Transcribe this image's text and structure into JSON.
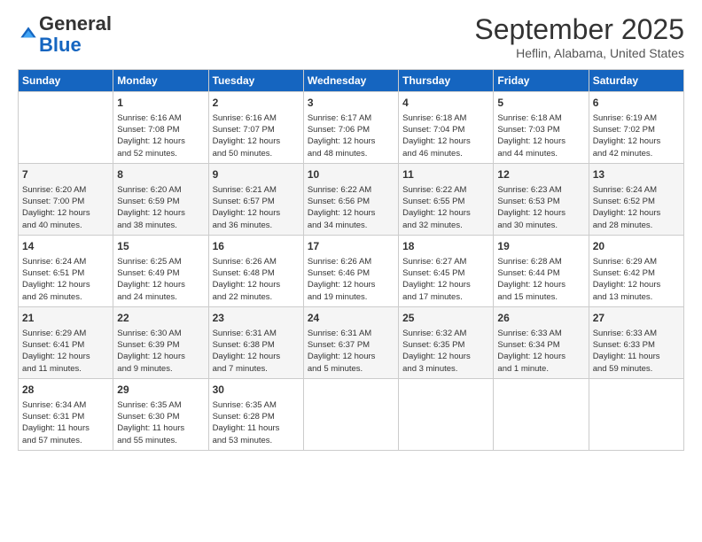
{
  "logo": {
    "general": "General",
    "blue": "Blue"
  },
  "title": "September 2025",
  "subtitle": "Heflin, Alabama, United States",
  "weekdays": [
    "Sunday",
    "Monday",
    "Tuesday",
    "Wednesday",
    "Thursday",
    "Friday",
    "Saturday"
  ],
  "weeks": [
    [
      {
        "day": "",
        "info": ""
      },
      {
        "day": "1",
        "info": "Sunrise: 6:16 AM\nSunset: 7:08 PM\nDaylight: 12 hours\nand 52 minutes."
      },
      {
        "day": "2",
        "info": "Sunrise: 6:16 AM\nSunset: 7:07 PM\nDaylight: 12 hours\nand 50 minutes."
      },
      {
        "day": "3",
        "info": "Sunrise: 6:17 AM\nSunset: 7:06 PM\nDaylight: 12 hours\nand 48 minutes."
      },
      {
        "day": "4",
        "info": "Sunrise: 6:18 AM\nSunset: 7:04 PM\nDaylight: 12 hours\nand 46 minutes."
      },
      {
        "day": "5",
        "info": "Sunrise: 6:18 AM\nSunset: 7:03 PM\nDaylight: 12 hours\nand 44 minutes."
      },
      {
        "day": "6",
        "info": "Sunrise: 6:19 AM\nSunset: 7:02 PM\nDaylight: 12 hours\nand 42 minutes."
      }
    ],
    [
      {
        "day": "7",
        "info": "Sunrise: 6:20 AM\nSunset: 7:00 PM\nDaylight: 12 hours\nand 40 minutes."
      },
      {
        "day": "8",
        "info": "Sunrise: 6:20 AM\nSunset: 6:59 PM\nDaylight: 12 hours\nand 38 minutes."
      },
      {
        "day": "9",
        "info": "Sunrise: 6:21 AM\nSunset: 6:57 PM\nDaylight: 12 hours\nand 36 minutes."
      },
      {
        "day": "10",
        "info": "Sunrise: 6:22 AM\nSunset: 6:56 PM\nDaylight: 12 hours\nand 34 minutes."
      },
      {
        "day": "11",
        "info": "Sunrise: 6:22 AM\nSunset: 6:55 PM\nDaylight: 12 hours\nand 32 minutes."
      },
      {
        "day": "12",
        "info": "Sunrise: 6:23 AM\nSunset: 6:53 PM\nDaylight: 12 hours\nand 30 minutes."
      },
      {
        "day": "13",
        "info": "Sunrise: 6:24 AM\nSunset: 6:52 PM\nDaylight: 12 hours\nand 28 minutes."
      }
    ],
    [
      {
        "day": "14",
        "info": "Sunrise: 6:24 AM\nSunset: 6:51 PM\nDaylight: 12 hours\nand 26 minutes."
      },
      {
        "day": "15",
        "info": "Sunrise: 6:25 AM\nSunset: 6:49 PM\nDaylight: 12 hours\nand 24 minutes."
      },
      {
        "day": "16",
        "info": "Sunrise: 6:26 AM\nSunset: 6:48 PM\nDaylight: 12 hours\nand 22 minutes."
      },
      {
        "day": "17",
        "info": "Sunrise: 6:26 AM\nSunset: 6:46 PM\nDaylight: 12 hours\nand 19 minutes."
      },
      {
        "day": "18",
        "info": "Sunrise: 6:27 AM\nSunset: 6:45 PM\nDaylight: 12 hours\nand 17 minutes."
      },
      {
        "day": "19",
        "info": "Sunrise: 6:28 AM\nSunset: 6:44 PM\nDaylight: 12 hours\nand 15 minutes."
      },
      {
        "day": "20",
        "info": "Sunrise: 6:29 AM\nSunset: 6:42 PM\nDaylight: 12 hours\nand 13 minutes."
      }
    ],
    [
      {
        "day": "21",
        "info": "Sunrise: 6:29 AM\nSunset: 6:41 PM\nDaylight: 12 hours\nand 11 minutes."
      },
      {
        "day": "22",
        "info": "Sunrise: 6:30 AM\nSunset: 6:39 PM\nDaylight: 12 hours\nand 9 minutes."
      },
      {
        "day": "23",
        "info": "Sunrise: 6:31 AM\nSunset: 6:38 PM\nDaylight: 12 hours\nand 7 minutes."
      },
      {
        "day": "24",
        "info": "Sunrise: 6:31 AM\nSunset: 6:37 PM\nDaylight: 12 hours\nand 5 minutes."
      },
      {
        "day": "25",
        "info": "Sunrise: 6:32 AM\nSunset: 6:35 PM\nDaylight: 12 hours\nand 3 minutes."
      },
      {
        "day": "26",
        "info": "Sunrise: 6:33 AM\nSunset: 6:34 PM\nDaylight: 12 hours\nand 1 minute."
      },
      {
        "day": "27",
        "info": "Sunrise: 6:33 AM\nSunset: 6:33 PM\nDaylight: 11 hours\nand 59 minutes."
      }
    ],
    [
      {
        "day": "28",
        "info": "Sunrise: 6:34 AM\nSunset: 6:31 PM\nDaylight: 11 hours\nand 57 minutes."
      },
      {
        "day": "29",
        "info": "Sunrise: 6:35 AM\nSunset: 6:30 PM\nDaylight: 11 hours\nand 55 minutes."
      },
      {
        "day": "30",
        "info": "Sunrise: 6:35 AM\nSunset: 6:28 PM\nDaylight: 11 hours\nand 53 minutes."
      },
      {
        "day": "",
        "info": ""
      },
      {
        "day": "",
        "info": ""
      },
      {
        "day": "",
        "info": ""
      },
      {
        "day": "",
        "info": ""
      }
    ]
  ]
}
